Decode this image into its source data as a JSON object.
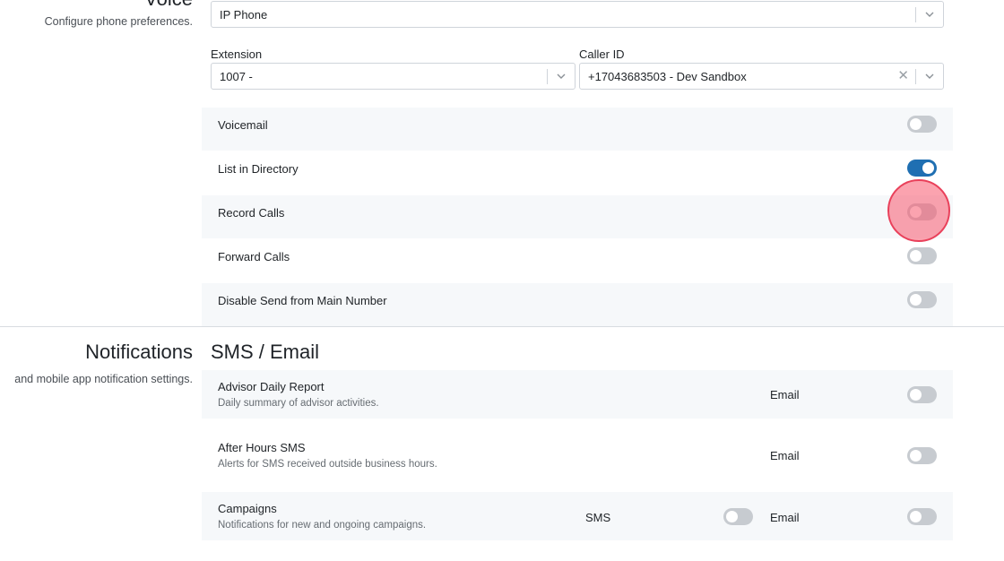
{
  "voice": {
    "title": "Voice",
    "subtitle": "Configure phone preferences.",
    "device": {
      "value": "IP Phone"
    },
    "extension": {
      "label": "Extension",
      "value": "1007 -"
    },
    "caller_id": {
      "label": "Caller ID",
      "value": "+17043683503 - Dev Sandbox"
    },
    "settings": [
      {
        "label": "Voicemail",
        "on": false
      },
      {
        "label": "List in Directory",
        "on": true
      },
      {
        "label": "Record Calls",
        "on": false
      },
      {
        "label": "Forward Calls",
        "on": false
      },
      {
        "label": "Disable Send from Main Number",
        "on": false
      }
    ]
  },
  "notifications": {
    "title": "Notifications",
    "subtitle": "and mobile app notification settings.",
    "group_title": "SMS / Email",
    "items": [
      {
        "label": "Advisor Daily Report",
        "description": "Daily summary of advisor activities.",
        "email_label": "Email",
        "email_on": false
      },
      {
        "label": "After Hours SMS",
        "description": "Alerts for SMS received outside business hours.",
        "email_label": "Email",
        "email_on": false
      },
      {
        "label": "Campaigns",
        "description": "Notifications for new and ongoing campaigns.",
        "sms_label": "SMS",
        "sms_on": false,
        "email_label": "Email",
        "email_on": false
      }
    ]
  },
  "colors": {
    "toggle_on": "#1f6fb2",
    "toggle_off": "#c7cbd0",
    "click_marker": "#e9405a"
  }
}
